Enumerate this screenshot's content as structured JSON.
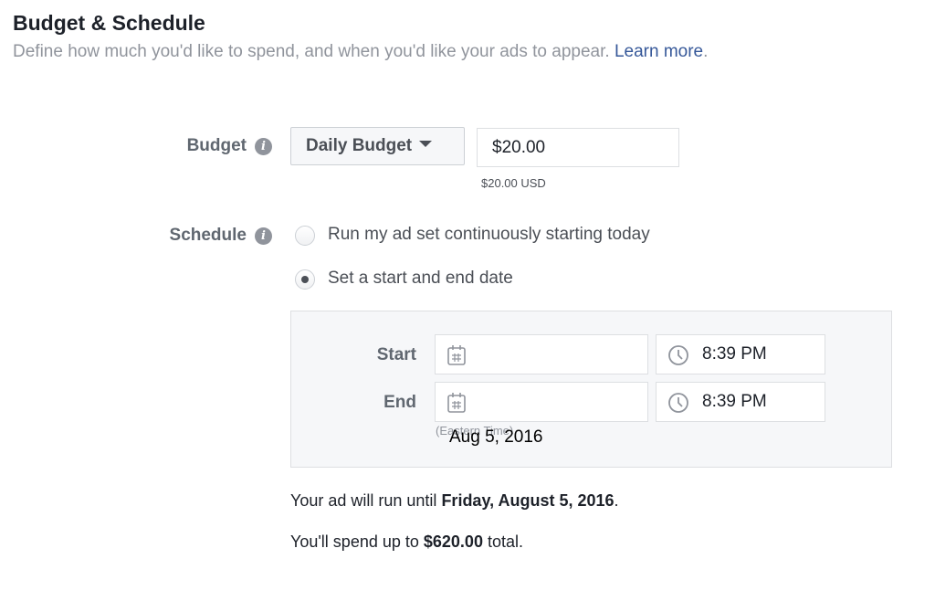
{
  "header": {
    "title": "Budget & Schedule",
    "subtitle": "Define how much you'd like to spend, and when you'd like your ads to appear.",
    "learn_more": "Learn more",
    "period": "."
  },
  "budget": {
    "label": "Budget",
    "type_selected": "Daily Budget",
    "amount_value": "$20.00",
    "amount_note": "$20.00 USD"
  },
  "schedule": {
    "label": "Schedule",
    "options": [
      {
        "label": "Run my ad set continuously starting today",
        "checked": false
      },
      {
        "label": "Set a start and end date",
        "checked": true
      }
    ],
    "start": {
      "label": "Start",
      "date": "",
      "time": "8:39 PM"
    },
    "end": {
      "label": "End",
      "date": "Aug 5, 2016",
      "time": "8:39 PM"
    },
    "timezone_note": "(Eastern Time)"
  },
  "summary": {
    "run_prefix": "Your ad will run until ",
    "run_date": "Friday, August 5, 2016",
    "run_suffix": ".",
    "spend_prefix": "You'll spend up to ",
    "spend_amount": "$620.00",
    "spend_suffix": " total."
  },
  "colors": {
    "link": "#365899",
    "panel_bg": "#f6f7f9"
  }
}
